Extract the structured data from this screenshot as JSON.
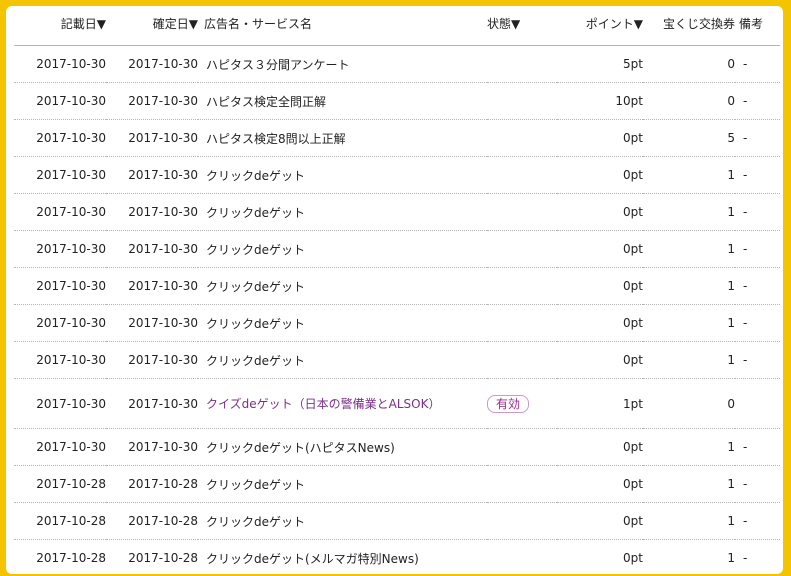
{
  "headers": {
    "record_date": "記載日▼",
    "confirm_date": "確定日▼",
    "ad_name": "広告名・サービス名",
    "status": "状態▼",
    "points": "ポイント▼",
    "lottery": "宝くじ交換券",
    "remarks": "備考"
  },
  "rows": [
    {
      "record": "2017-10-30",
      "confirm": "2017-10-30",
      "name": "ハピタス３分間アンケート",
      "status": "",
      "points": "5pt",
      "lottery": "0",
      "remarks": "-"
    },
    {
      "record": "2017-10-30",
      "confirm": "2017-10-30",
      "name": "ハピタス検定全問正解",
      "status": "",
      "points": "10pt",
      "lottery": "0",
      "remarks": "-"
    },
    {
      "record": "2017-10-30",
      "confirm": "2017-10-30",
      "name": "ハピタス検定8問以上正解",
      "status": "",
      "points": "0pt",
      "lottery": "5",
      "remarks": "-"
    },
    {
      "record": "2017-10-30",
      "confirm": "2017-10-30",
      "name": "クリックdeゲット",
      "status": "",
      "points": "0pt",
      "lottery": "1",
      "remarks": "-"
    },
    {
      "record": "2017-10-30",
      "confirm": "2017-10-30",
      "name": "クリックdeゲット",
      "status": "",
      "points": "0pt",
      "lottery": "1",
      "remarks": "-"
    },
    {
      "record": "2017-10-30",
      "confirm": "2017-10-30",
      "name": "クリックdeゲット",
      "status": "",
      "points": "0pt",
      "lottery": "1",
      "remarks": "-"
    },
    {
      "record": "2017-10-30",
      "confirm": "2017-10-30",
      "name": "クリックdeゲット",
      "status": "",
      "points": "0pt",
      "lottery": "1",
      "remarks": "-"
    },
    {
      "record": "2017-10-30",
      "confirm": "2017-10-30",
      "name": "クリックdeゲット",
      "status": "",
      "points": "0pt",
      "lottery": "1",
      "remarks": "-"
    },
    {
      "record": "2017-10-30",
      "confirm": "2017-10-30",
      "name": "クリックdeゲット",
      "status": "",
      "points": "0pt",
      "lottery": "1",
      "remarks": "-"
    },
    {
      "record": "2017-10-30",
      "confirm": "2017-10-30",
      "name": "クイズdeゲット（日本の警備業とALSOK）",
      "status": "有効",
      "points": "1pt",
      "lottery": "0",
      "remarks": ""
    },
    {
      "record": "2017-10-30",
      "confirm": "2017-10-30",
      "name": "クリックdeゲット(ハピタスNews)",
      "status": "",
      "points": "0pt",
      "lottery": "1",
      "remarks": "-"
    },
    {
      "record": "2017-10-28",
      "confirm": "2017-10-28",
      "name": "クリックdeゲット",
      "status": "",
      "points": "0pt",
      "lottery": "1",
      "remarks": "-"
    },
    {
      "record": "2017-10-28",
      "confirm": "2017-10-28",
      "name": "クリックdeゲット",
      "status": "",
      "points": "0pt",
      "lottery": "1",
      "remarks": "-"
    },
    {
      "record": "2017-10-28",
      "confirm": "2017-10-28",
      "name": "クリックdeゲット(メルマガ特別News)",
      "status": "",
      "points": "0pt",
      "lottery": "1",
      "remarks": "-"
    }
  ],
  "colors": {
    "background": "#f5c400",
    "panel": "#ffffff",
    "link_purple": "#7b2f8a",
    "badge_border": "#c99bc9"
  }
}
